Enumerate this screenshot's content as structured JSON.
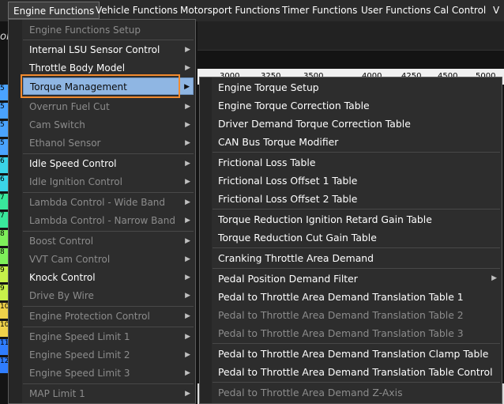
{
  "menubar": {
    "items": [
      {
        "label": "Engine Functions"
      },
      {
        "label": "Vehicle Functions"
      },
      {
        "label": "Motorsport Functions"
      },
      {
        "label": "Timer Functions"
      },
      {
        "label": "User Functions"
      },
      {
        "label": "Cal Control"
      },
      {
        "label": "V"
      }
    ]
  },
  "background": {
    "title_fragment": "ola",
    "axis_values": [
      "3000",
      "3250",
      "3500",
      "4000",
      "4250",
      "4500",
      "5000"
    ],
    "row_labels": [
      "5",
      "5",
      "5",
      "5",
      "6",
      "6",
      "7",
      "7",
      "8",
      "8",
      "9",
      "9",
      "10",
      "10",
      "11",
      "12"
    ]
  },
  "engine_menu": {
    "items": [
      {
        "label": "Engine Functions Setup",
        "enabled": false
      },
      {
        "label": "Internal LSU Sensor Control",
        "enabled": true
      },
      {
        "label": "Throttle Body Model",
        "enabled": true
      },
      {
        "label": "Torque Management",
        "enabled": true,
        "highlighted": true
      },
      {
        "label": "Overrun Fuel Cut",
        "enabled": false
      },
      {
        "label": "Cam Switch",
        "enabled": false
      },
      {
        "label": "Ethanol Sensor",
        "enabled": false
      },
      {
        "label": "Idle Speed Control",
        "enabled": true
      },
      {
        "label": "Idle Ignition Control",
        "enabled": false
      },
      {
        "label": "Lambda Control - Wide Band",
        "enabled": false
      },
      {
        "label": "Lambda Control - Narrow Band",
        "enabled": false
      },
      {
        "label": "Boost Control",
        "enabled": false
      },
      {
        "label": "VVT Cam Control",
        "enabled": false
      },
      {
        "label": "Knock Control",
        "enabled": true
      },
      {
        "label": "Drive By Wire",
        "enabled": false
      },
      {
        "label": "Engine Protection Control",
        "enabled": false
      },
      {
        "label": "Engine Speed Limit 1",
        "enabled": false
      },
      {
        "label": "Engine Speed Limit 2",
        "enabled": false
      },
      {
        "label": "Engine Speed Limit 3",
        "enabled": false
      },
      {
        "label": "MAP Limit 1",
        "enabled": false
      }
    ]
  },
  "torque_menu": {
    "items": [
      {
        "label": "Engine Torque Setup",
        "enabled": true
      },
      {
        "label": "Engine Torque Correction Table",
        "enabled": true
      },
      {
        "label": "Driver Demand Torque Correction Table",
        "enabled": true
      },
      {
        "label": "CAN Bus Torque Modifier",
        "enabled": true
      },
      {
        "label": "Frictional Loss Table",
        "enabled": true
      },
      {
        "label": "Frictional Loss Offset 1 Table",
        "enabled": true
      },
      {
        "label": "Frictional Loss Offset 2 Table",
        "enabled": true
      },
      {
        "label": "Torque Reduction Ignition Retard Gain Table",
        "enabled": true
      },
      {
        "label": "Torque Reduction Cut Gain Table",
        "enabled": true
      },
      {
        "label": "Cranking Throttle Area Demand",
        "enabled": true
      },
      {
        "label": "Pedal Position Demand Filter",
        "enabled": true
      },
      {
        "label": "Pedal to Throttle Area Demand Translation Table 1",
        "enabled": true
      },
      {
        "label": "Pedal to Throttle Area Demand Translation Table 2",
        "enabled": false
      },
      {
        "label": "Pedal to Throttle Area Demand Translation Table 3",
        "enabled": false
      },
      {
        "label": "Pedal to Throttle Area Demand Translation Clamp Table",
        "enabled": true
      },
      {
        "label": "Pedal to Throttle Area Demand Translation Table Control",
        "enabled": true
      },
      {
        "label": "Pedal to Throttle Area Demand Z-Axis",
        "enabled": false
      }
    ]
  },
  "colors": {
    "highlight": "#8fb6e3",
    "focus_outline": "#f28a2e",
    "menu_bg": "#2d2d2d",
    "disabled_text": "#8c8c8c",
    "row_colors": [
      "#4aa3ff",
      "#4aa3ff",
      "#4aa3ff",
      "#4aa3ff",
      "#3ad4e8",
      "#3ad4e8",
      "#39e89b",
      "#39e89b",
      "#7ef05a",
      "#7ef05a",
      "#c6f04a",
      "#c6f04a",
      "#f0d24a",
      "#f0d24a",
      "#2f7dff",
      "#2f7dff"
    ]
  }
}
